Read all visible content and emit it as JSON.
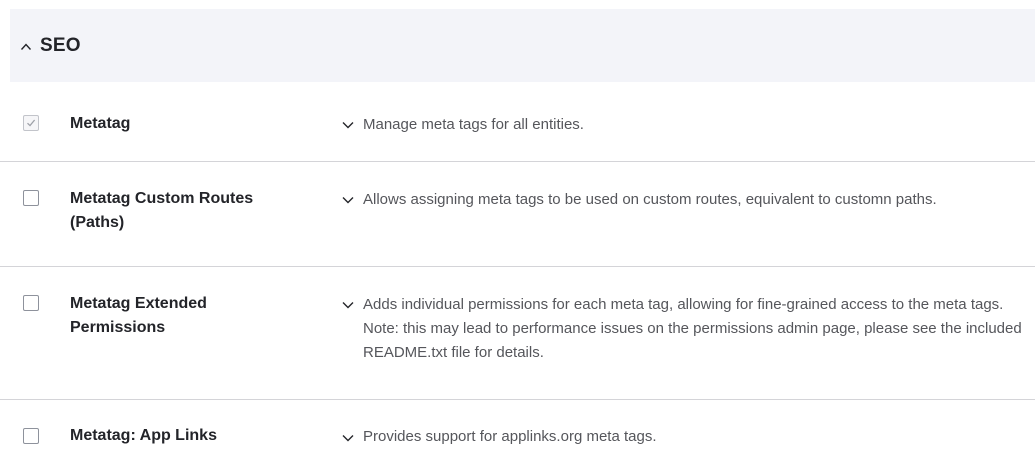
{
  "section": {
    "title": "SEO",
    "expanded_icon": "chevron-up-icon"
  },
  "modules": [
    {
      "name": "Metatag",
      "description": "Manage meta tags for all entities.",
      "checked": true,
      "disabled": true
    },
    {
      "name": "Metatag Custom Routes (Paths)",
      "description": "Allows assigning meta tags to be used on custom routes, equivalent to customn paths.",
      "checked": false,
      "disabled": false
    },
    {
      "name": "Metatag Extended Permissions",
      "description": "Adds individual permissions for each meta tag, allowing for fine-grained access to the meta tags. Note: this may lead to performance issues on the permissions admin page, please see the included README.txt file for details.",
      "checked": false,
      "disabled": false
    },
    {
      "name": "Metatag: App Links",
      "description": "Provides support for applinks.org meta tags.",
      "checked": false,
      "disabled": false
    }
  ],
  "colors": {
    "header_bg": "#f3f4f9",
    "text": "#232429",
    "description": "#55565b",
    "divider": "#d4d4d8"
  }
}
